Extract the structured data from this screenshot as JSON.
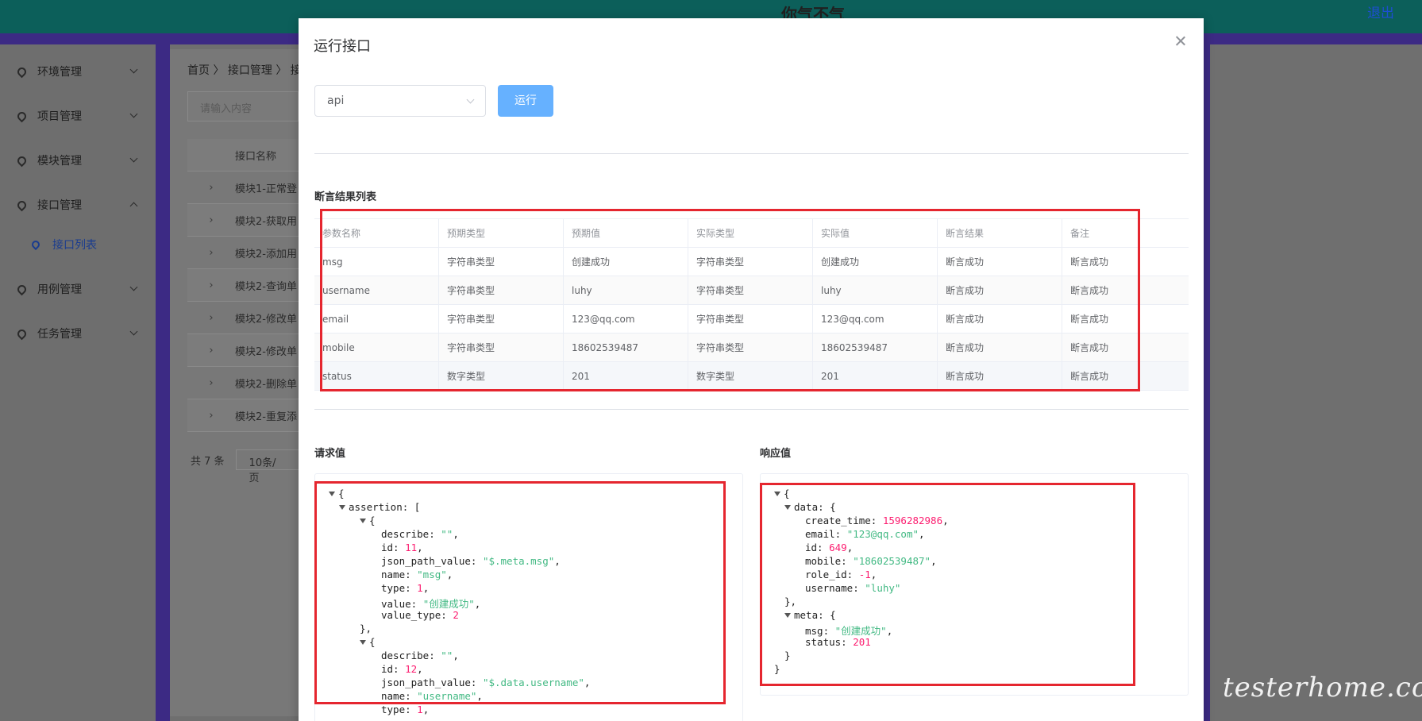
{
  "app": {
    "title": "你气不气",
    "logout": "退出"
  },
  "sidebar": {
    "items": [
      {
        "label": "环境管理"
      },
      {
        "label": "项目管理"
      },
      {
        "label": "模块管理"
      },
      {
        "label": "接口管理"
      },
      {
        "label": "用例管理"
      },
      {
        "label": "任务管理"
      }
    ],
    "sub_item": "接口列表"
  },
  "background": {
    "breadcrumb": "首页 〉 接口管理 〉 接",
    "search_placeholder": "请输入内容",
    "table_header": "接口名称",
    "rows": [
      "模块1-正常登",
      "模块2-获取用",
      "模块2-添加用",
      "模块2-查询单",
      "模块2-修改单",
      "模块2-修改单",
      "模块2-删除单",
      "模块2-重复添"
    ],
    "total": "共 7 条",
    "page_size": "10条/页"
  },
  "dialog": {
    "title": "运行接口",
    "select_value": "api",
    "run_label": "运行",
    "assert_title": "断言结果列表",
    "request_title": "请求值",
    "response_title": "响应值"
  },
  "assert_table": {
    "headers": [
      "参数名称",
      "预期类型",
      "预期值",
      "实际类型",
      "实际值",
      "断言结果",
      "备注"
    ],
    "rows": [
      [
        "msg",
        "字符串类型",
        "创建成功",
        "字符串类型",
        "创建成功",
        "断言成功",
        "断言成功"
      ],
      [
        "username",
        "字符串类型",
        "luhy",
        "字符串类型",
        "luhy",
        "断言成功",
        "断言成功"
      ],
      [
        "email",
        "字符串类型",
        "123@qq.com",
        "字符串类型",
        "123@qq.com",
        "断言成功",
        "断言成功"
      ],
      [
        "mobile",
        "字符串类型",
        "18602539487",
        "字符串类型",
        "18602539487",
        "断言成功",
        "断言成功"
      ],
      [
        "status",
        "数字类型",
        "201",
        "数字类型",
        "201",
        "断言成功",
        "断言成功"
      ]
    ]
  },
  "request_json": {
    "lines": [
      {
        "p": "{"
      },
      {
        "k": "assertion",
        "p": "["
      },
      {
        "p": "{"
      },
      {
        "k": "describe",
        "s": "\"\"",
        "e": ","
      },
      {
        "k": "id",
        "n": "11",
        "e": ","
      },
      {
        "k": "json_path_value",
        "s": "\"$.meta.msg\"",
        "e": ","
      },
      {
        "k": "name",
        "s": "\"msg\"",
        "e": ","
      },
      {
        "k": "type",
        "n": "1",
        "e": ","
      },
      {
        "k": "value",
        "s": "\"创建成功\"",
        "e": ","
      },
      {
        "k": "value_type",
        "n": "2"
      },
      {
        "p": "},"
      },
      {
        "p": "{"
      },
      {
        "k": "describe",
        "s": "\"\"",
        "e": ","
      },
      {
        "k": "id",
        "n": "12",
        "e": ","
      },
      {
        "k": "json_path_value",
        "s": "\"$.data.username\"",
        "e": ","
      },
      {
        "k": "name",
        "s": "\"username\"",
        "e": ","
      },
      {
        "k": "type",
        "n": "1",
        "e": ","
      }
    ]
  },
  "response_json": {
    "lines": [
      {
        "p": "{"
      },
      {
        "k": "data",
        "p": "{"
      },
      {
        "k": "create_time",
        "n": "1596282986",
        "e": ","
      },
      {
        "k": "email",
        "s": "\"123@qq.com\"",
        "e": ","
      },
      {
        "k": "id",
        "n": "649",
        "e": ","
      },
      {
        "k": "mobile",
        "s": "\"18602539487\"",
        "e": ","
      },
      {
        "k": "role_id",
        "n": "-1",
        "e": ","
      },
      {
        "k": "username",
        "s": "\"luhy\""
      },
      {
        "p": "},"
      },
      {
        "k": "meta",
        "p": "{"
      },
      {
        "k": "msg",
        "s": "\"创建成功\"",
        "e": ","
      },
      {
        "k": "status",
        "n": "201"
      },
      {
        "p": "}"
      },
      {
        "p": "}"
      }
    ]
  },
  "watermark": "testerhome.com",
  "colors": {
    "header": "#0c5f5a",
    "accent_purple": "#3c2a84",
    "primary_button": "#66b1ff",
    "highlight_box": "#e5262f",
    "json_string": "#42b983",
    "json_number": "#fc1e70"
  }
}
